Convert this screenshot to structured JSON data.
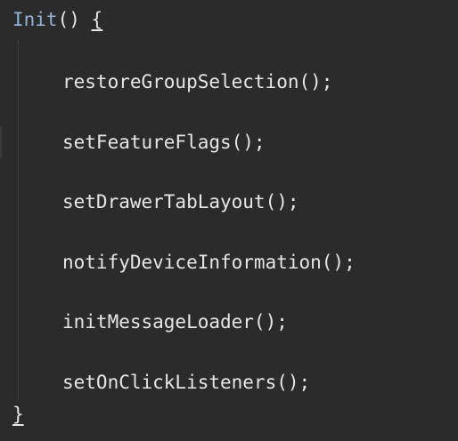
{
  "code": {
    "function_name": "Init",
    "function_params": "()",
    "open_brace": "{",
    "close_brace": "}",
    "calls": [
      "restoreGroupSelection();",
      "setFeatureFlags();",
      "setDrawerTabLayout();",
      "notifyDeviceInformation();",
      "initMessageLoader();",
      "setOnClickListeners();"
    ]
  },
  "colors": {
    "background": "#2b2b2b",
    "function_name": "#8fb3d9",
    "text": "#e6e6e6"
  }
}
